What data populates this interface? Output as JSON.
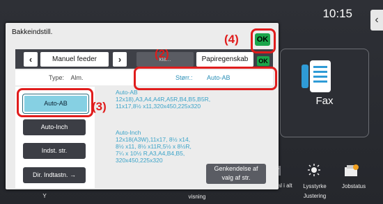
{
  "status": {
    "time": "10:15"
  },
  "panel": {
    "title": "Bakkeindstill.",
    "ok_label": "OK",
    "tabs": {
      "manual_feeder": "Manuel feeder",
      "hidden_tab": "kla...",
      "paper_cassette": "Papiregenskab"
    },
    "info": {
      "type_label": "Type:",
      "type_value": "Alm.",
      "size_label": "Størr.:",
      "size_value": "Auto-AB"
    },
    "size_buttons": [
      "Auto-AB",
      "Auto-Inch",
      "Indst. str.",
      "Dir. Indtastn."
    ],
    "auto_ab_title": "Auto-AB",
    "auto_ab_list": [
      "12x18),A3,A4,A4R,A5R,B4,B5,B5R,",
      "11x17,8½ x11,320x450,225x320"
    ],
    "auto_inch_title": "Auto-Inch",
    "auto_inch_list": [
      "12x18(A3W),11x17, 8½ x14,",
      "8½ x11, 8½ x11R,5½ x 8½R,",
      "7¼ x 10½ R,A3,A4,B4,B5,",
      "320x450,225x320"
    ],
    "recognize_button": [
      "Genkendelse af",
      "valg af str."
    ]
  },
  "callouts": [
    "(2)",
    "(3)",
    "(4)"
  ],
  "home": {
    "fax_label": "Fax"
  },
  "bottom_bar": {
    "labels": [
      "Y",
      "visning",
      "tal i alt",
      "Lysstyrke",
      "Justering",
      "Jobstatus"
    ]
  },
  "colors": {
    "ok_green": "#1aa54a",
    "selection": "#86d0e3",
    "annotation_red": "#e01c1c",
    "link_blue": "#2a8fb7"
  }
}
